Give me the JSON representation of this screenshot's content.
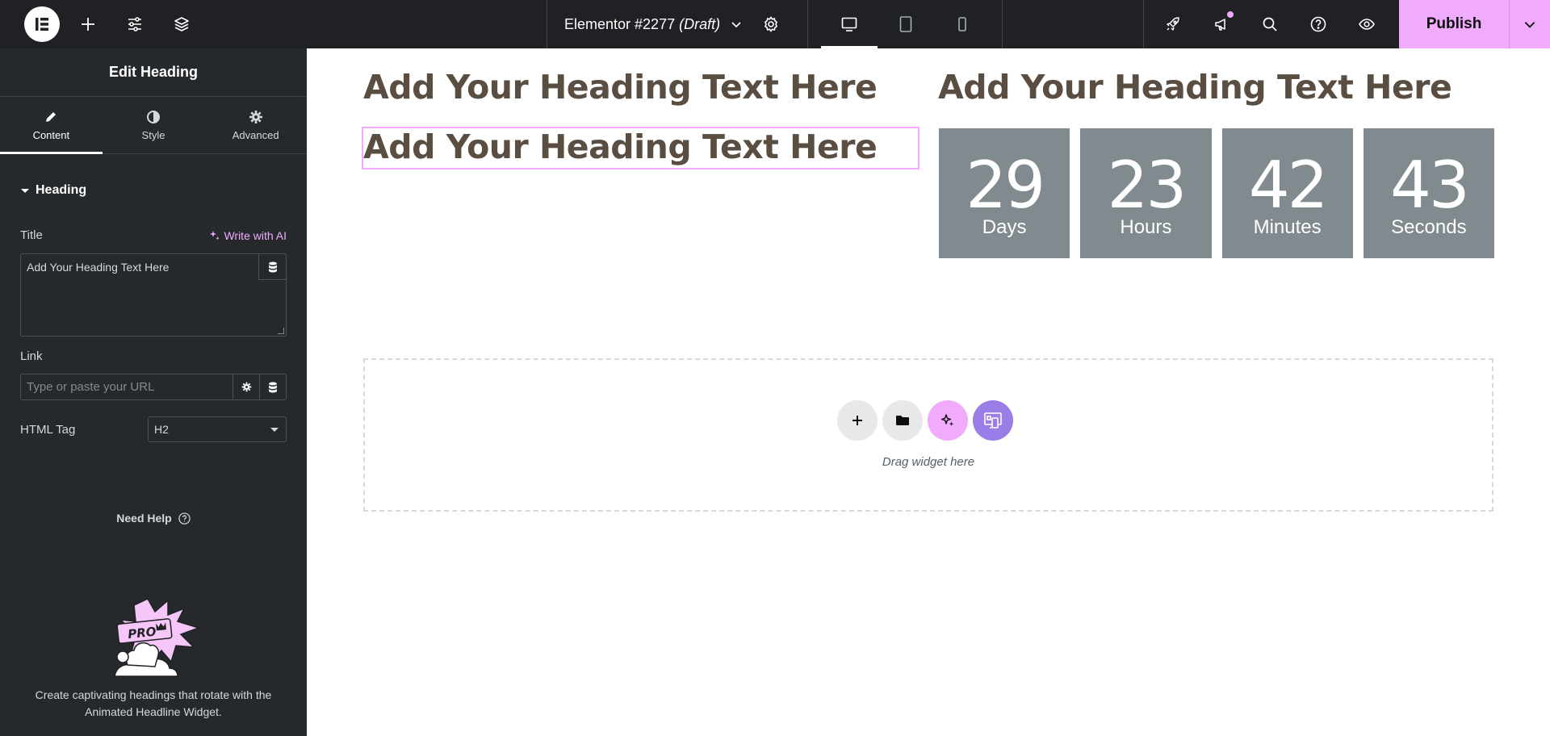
{
  "colors": {
    "accent": "#f0abfc",
    "panel": "#26292c",
    "topbar": "#1f2124",
    "countdown_bg": "#818a8f",
    "heading": "#5a4e43"
  },
  "topbar": {
    "doc_name": "Elementor #2277",
    "doc_status": "(Draft)",
    "publish_label": "Publish",
    "icons": [
      "elementor-logo-icon",
      "add-element-icon",
      "site-settings-icon",
      "structure-icon",
      "page-settings-icon",
      "desktop-icon",
      "tablet-icon",
      "mobile-icon",
      "launchpad-icon",
      "whats-new-icon",
      "search-icon",
      "help-icon",
      "preview-icon",
      "chevron-down-icon"
    ]
  },
  "sidebar": {
    "panel_title": "Edit Heading",
    "tabs": [
      {
        "label": "Content",
        "icon": "pencil-icon"
      },
      {
        "label": "Style",
        "icon": "contrast-icon"
      },
      {
        "label": "Advanced",
        "icon": "gear-icon"
      }
    ],
    "section_title": "Heading",
    "title_label": "Title",
    "write_ai_label": "Write with AI",
    "title_value": "Add Your Heading Text Here",
    "link_label": "Link",
    "link_placeholder": "Type or paste your URL",
    "html_tag_label": "HTML Tag",
    "html_tag_value": "H2",
    "need_help_label": "Need Help",
    "promo_badge": "PRO",
    "promo_text": "Create captivating headings that rotate with the Animated Headline Widget."
  },
  "canvas": {
    "heading_1": "Add Your Heading Text Here",
    "heading_2": "Add Your Heading Text Here",
    "heading_3": "Add Your Heading Text Here",
    "countdown": [
      {
        "value": "29",
        "label": "Days"
      },
      {
        "value": "23",
        "label": "Hours"
      },
      {
        "value": "42",
        "label": "Minutes"
      },
      {
        "value": "43",
        "label": "Seconds"
      }
    ],
    "drop_text": "Drag widget here"
  }
}
